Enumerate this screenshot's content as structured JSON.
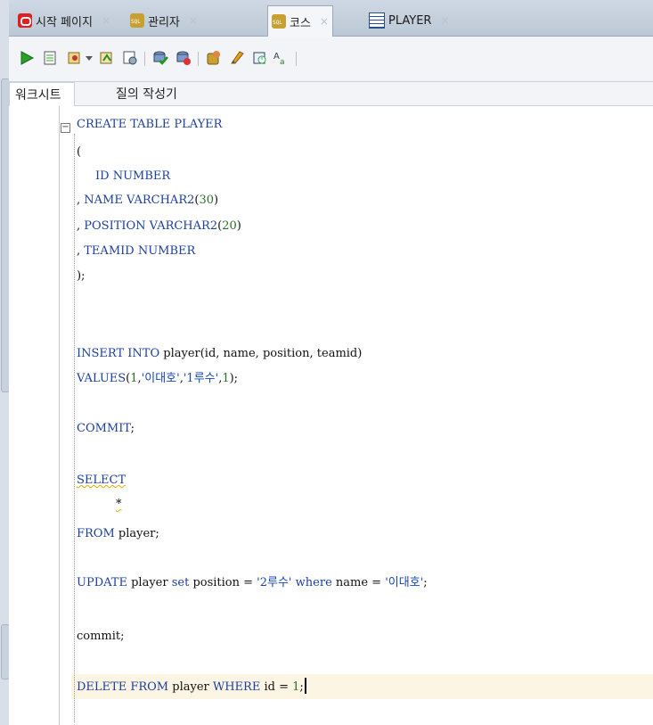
{
  "tabs": [
    {
      "label": "시작 페이지",
      "icon": "oracle-icon"
    },
    {
      "label": "관리자",
      "icon": "sql-worksheet-icon"
    },
    {
      "label": "코스",
      "icon": "sql-worksheet-icon"
    },
    {
      "label": "PLAYER",
      "icon": "table-grid-icon"
    }
  ],
  "close_glyph": "×",
  "subtabs": [
    "워크시트",
    "질의 작성기"
  ],
  "toolbar": [
    "run-statement-icon",
    "run-script-icon",
    "autotrace-icon",
    "dropdown-arrow-icon",
    "explain-plan-icon",
    "sql-tuning-icon",
    "commit-icon",
    "rollback-icon",
    "unshared-sql-icon",
    "clear-icon",
    "history-icon",
    "format-case-icon"
  ],
  "code": {
    "l1": {
      "k1": "CREATE TABLE PLAYER"
    },
    "l2": {
      "t": "("
    },
    "l3": {
      "k": "ID NUMBER"
    },
    "l4": {
      "p": ", ",
      "k": "NAME VARCHAR2",
      "o": "(",
      "n": "30",
      "c": ")"
    },
    "l5": {
      "p": ", ",
      "k": "POSITION VARCHAR2",
      "o": "(",
      "n": "20",
      "c": ")"
    },
    "l6": {
      "p": ", ",
      "k": "TEAMID NUMBER"
    },
    "l7": {
      "t": ");"
    },
    "l8": {
      "k": "INSERT INTO",
      "t": " player(id, name, position, teamid)"
    },
    "l9": {
      "k": "VALUES",
      "a": "(",
      "n1": "1",
      "b": ",",
      "s1": "'이대호'",
      "c": ",",
      "s2": "'1루수'",
      "d": ",",
      "n2": "1",
      "e": ");"
    },
    "l10": {
      "k": "COMMIT",
      "t": ";"
    },
    "l11": {
      "k": "SELECT"
    },
    "l12": {
      "t": "*"
    },
    "l13": {
      "k": "FROM",
      "t": " player;"
    },
    "l14": {
      "k1": "UPDATE",
      "t1": " player ",
      "k2": "set",
      "t2": " position = ",
      "s1": "'2루수'",
      "t3": " ",
      "k3": "where",
      "t4": " name = ",
      "s2": "'이대호'",
      "t5": ";"
    },
    "l15": {
      "t": "commit;"
    },
    "l16": {
      "k1": "DELETE FROM",
      "t1": " player ",
      "k2": "WHERE",
      "t2": " id = ",
      "n": "1",
      "t3": ";"
    }
  }
}
